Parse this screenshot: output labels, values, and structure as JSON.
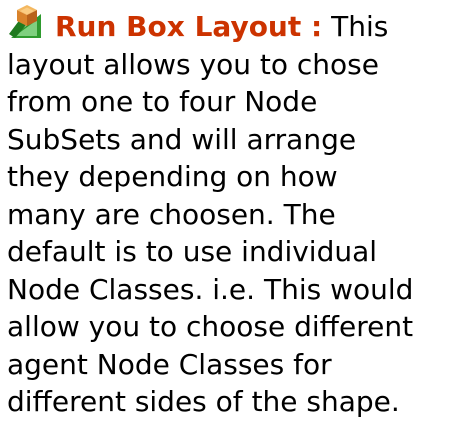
{
  "topic": {
    "icon": "node-box-icon",
    "heading": "Run Box Layout :",
    "heading_color": "#cc3300",
    "lines": [
      "This",
      "layout allows you to chose",
      "from one to four Node",
      "SubSets and will arrange",
      "they depending on how",
      "many are choosen. The",
      "default is to use individual",
      "Node Classes. i.e. This would",
      "allow you to choose different",
      "agent Node Classes for",
      "different sides of the shape."
    ]
  }
}
